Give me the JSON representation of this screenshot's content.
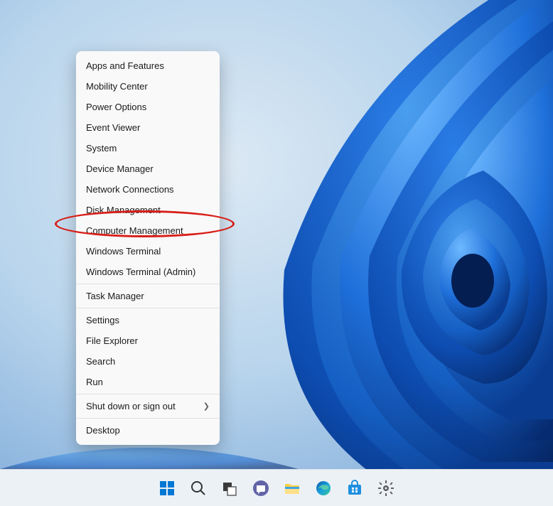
{
  "menu": {
    "groups": [
      [
        "Apps and Features",
        "Mobility Center",
        "Power Options",
        "Event Viewer",
        "System",
        "Device Manager",
        "Network Connections",
        "Disk Management",
        "Computer Management",
        "Windows Terminal",
        "Windows Terminal (Admin)"
      ],
      [
        "Task Manager"
      ],
      [
        "Settings",
        "File Explorer",
        "Search",
        "Run"
      ],
      [
        "Shut down or sign out"
      ],
      [
        "Desktop"
      ]
    ],
    "submenu_item": "Shut down or sign out",
    "highlighted_item": "Disk Management"
  },
  "taskbar": {
    "icons": [
      "start",
      "search",
      "task-view",
      "chat",
      "file-explorer",
      "edge",
      "store",
      "settings"
    ]
  },
  "colors": {
    "highlight_ring": "#d91e18",
    "menu_bg": "#f9f9f9",
    "taskbar_bg": "rgba(238,242,246,0.75)"
  }
}
